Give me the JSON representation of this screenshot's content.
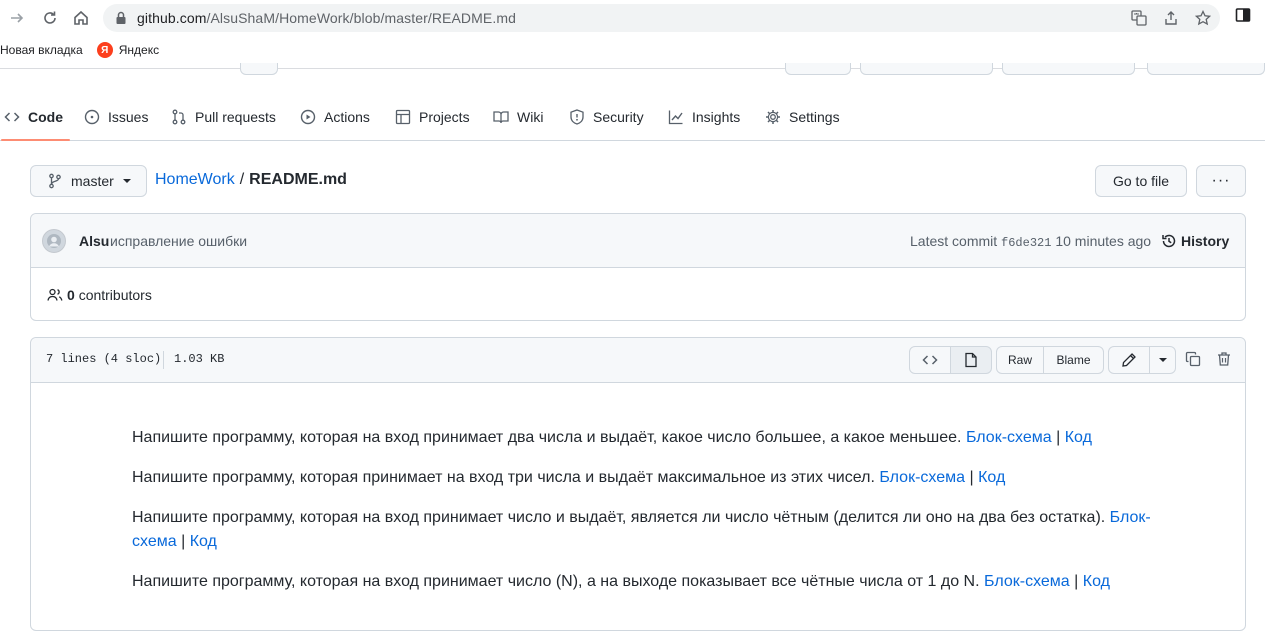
{
  "browser": {
    "url_host": "github.com",
    "url_path": "/AlsuShaM/HomeWork/blob/master/README.md",
    "bookmarks": [
      {
        "label": "Новая вкладка"
      },
      {
        "label": "Яндекс",
        "icon": "yandex-icon",
        "icon_letter": "Я"
      }
    ]
  },
  "repo_nav": {
    "tabs": [
      {
        "label": "Code",
        "icon": "code-icon",
        "selected": true
      },
      {
        "label": "Issues",
        "icon": "issue-icon"
      },
      {
        "label": "Pull requests",
        "icon": "pull-request-icon"
      },
      {
        "label": "Actions",
        "icon": "play-icon"
      },
      {
        "label": "Projects",
        "icon": "table-icon"
      },
      {
        "label": "Wiki",
        "icon": "book-icon"
      },
      {
        "label": "Security",
        "icon": "shield-icon"
      },
      {
        "label": "Insights",
        "icon": "graph-icon"
      },
      {
        "label": "Settings",
        "icon": "gear-icon"
      }
    ]
  },
  "file_nav": {
    "branch": "master",
    "repo": "HomeWork",
    "separator": "/",
    "file": "README.md",
    "go_to_file": "Go to file",
    "more": "···"
  },
  "commit": {
    "author": "Alsu",
    "message": "исправление ошибки",
    "latest_label": "Latest commit",
    "sha": "f6de321",
    "time": "10 minutes ago",
    "history": "History",
    "contributors_count": "0",
    "contributors_label": "contributors"
  },
  "file": {
    "lines": "7 lines (4 sloc)",
    "size": "1.03 KB",
    "raw": "Raw",
    "blame": "Blame"
  },
  "readme": {
    "separator": "|",
    "items": [
      {
        "text": "Напишите программу, которая на вход принимает два числа и выдаёт, какое число большее, а какое меньшее.",
        "link1": "Блок-схема",
        "link2": "Код"
      },
      {
        "text": "Напишите программу, которая принимает на вход три числа и выдаёт максимальное из этих чисел.",
        "link1": "Блок-схема",
        "link2": "Код"
      },
      {
        "text": "Напишите программу, которая на вход принимает число и выдаёт, является ли число чётным (делится ли оно на два без остатка).",
        "link1": "Блок-схема",
        "link2": "Код"
      },
      {
        "text": "Напишите программу, которая на вход принимает число (N), а на выходе показывает все чётные числа от 1 до N.",
        "link1": "Блок-схема",
        "link2": "Код"
      }
    ]
  },
  "colors": {
    "accent_link": "#0969da",
    "tab_underline": "#fd8c73",
    "border": "#d0d7de"
  }
}
